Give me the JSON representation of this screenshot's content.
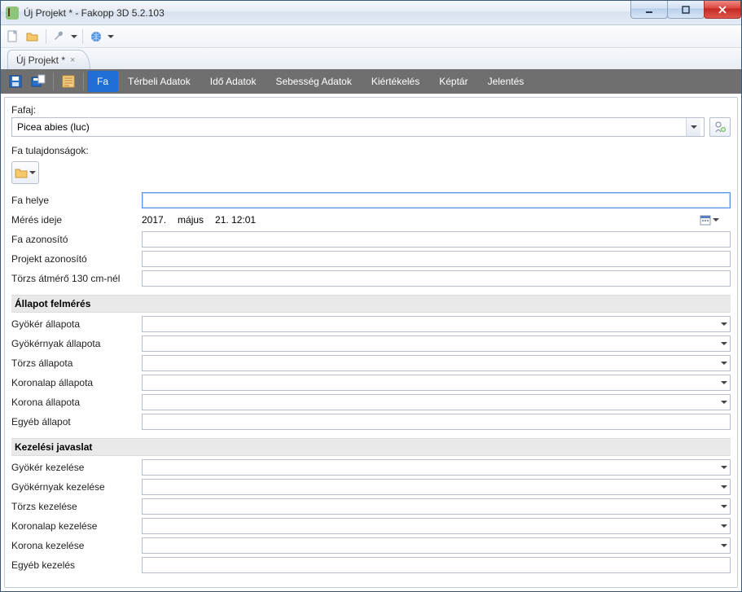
{
  "window": {
    "title": "Új Projekt * - Fakopp 3D 5.2.103"
  },
  "doctab": {
    "label": "Új Projekt *"
  },
  "ribbon": {
    "tabs": {
      "fa": "Fa",
      "terbeli": "Térbeli Adatok",
      "ido": "Idő Adatok",
      "sebesseg": "Sebesség Adatok",
      "kiertekeles": "Kiértékelés",
      "keptar": "Képtár",
      "jelentes": "Jelentés"
    }
  },
  "form": {
    "fafaj_label": "Fafaj:",
    "fafaj_value": "Picea abies (luc)",
    "fatul_label": "Fa tulajdonságok:",
    "rows": {
      "fa_helye": "Fa helye",
      "meres_ideje": "Mérés ideje",
      "fa_azonosito": "Fa azonosító",
      "projekt_azonosito": "Projekt azonosító",
      "torzs_atmero": "Törzs átmérő 130 cm-nél"
    },
    "date": {
      "year": "2017.",
      "month": "május",
      "day_time": "21. 12:01"
    },
    "section_allapot": "Állapot felmérés",
    "allapot_rows": {
      "gyoker": "Gyökér állapota",
      "gyokernyak": "Gyökérnyak állapota",
      "torzs": "Törzs állapota",
      "koronalap": "Koronalap állapota",
      "korona": "Korona állapota",
      "egyeb": "Egyéb állapot"
    },
    "section_kezeles": "Kezelési javaslat",
    "kezeles_rows": {
      "gyoker": "Gyökér kezelése",
      "gyokernyak": "Gyökérnyak kezelése",
      "torzs": "Törzs kezelése",
      "koronalap": "Koronalap kezelése",
      "korona": "Korona kezelése",
      "egyeb": "Egyéb kezelés"
    }
  }
}
